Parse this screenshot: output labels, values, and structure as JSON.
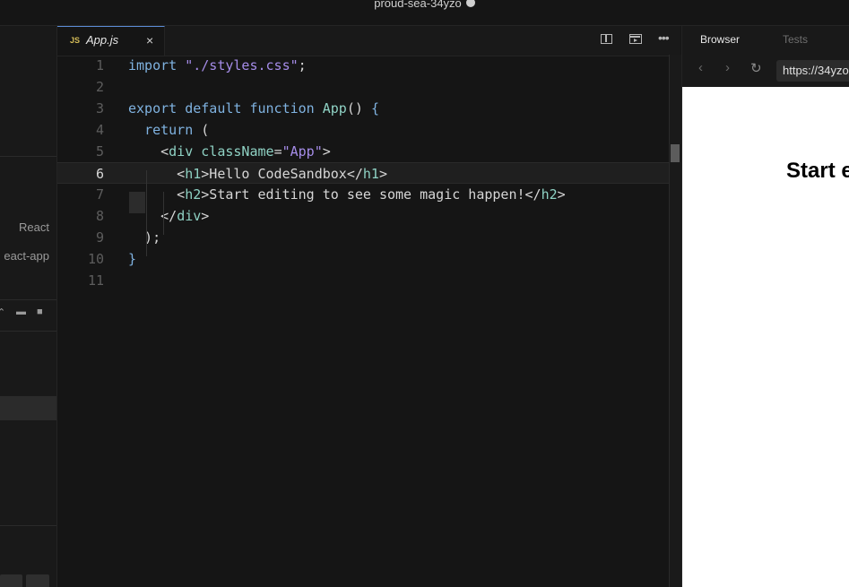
{
  "sandbox": {
    "title": "proud-sea-34yzo"
  },
  "sidebar": {
    "template_label": "React",
    "template_name": "eact-app"
  },
  "editor": {
    "tab": {
      "lang": "JS",
      "filename": "App.js",
      "close": "×"
    },
    "active_line": 6,
    "lines": [
      {
        "n": "1",
        "html": "<span class=\"kw\">import</span> <span class=\"str\">\"./styles.css\"</span>;"
      },
      {
        "n": "2",
        "html": ""
      },
      {
        "n": "3",
        "html": "<span class=\"kw\">export default function</span> <span class=\"fn\">App</span>() <span class=\"br\">{</span>"
      },
      {
        "n": "4",
        "html": "  <span class=\"kw\">return</span> ("
      },
      {
        "n": "5",
        "html": "    &lt;<span class=\"tag\">div</span> <span class=\"attr\">className</span>=<span class=\"str\">\"App\"</span>&gt;"
      },
      {
        "n": "6",
        "html": "      &lt;<span class=\"tag\">h1</span>&gt;Hello CodeSandbox&lt;/<span class=\"tag\">h1</span>&gt;"
      },
      {
        "n": "7",
        "html": "      &lt;<span class=\"tag\">h2</span>&gt;Start editing to see some magic happen!&lt;/<span class=\"tag\">h2</span>&gt;"
      },
      {
        "n": "8",
        "html": "    &lt;/<span class=\"tag\">div</span>&gt;"
      },
      {
        "n": "9",
        "html": "  );"
      },
      {
        "n": "10",
        "html": "<span class=\"br\">}</span>"
      },
      {
        "n": "11",
        "html": ""
      }
    ]
  },
  "preview": {
    "tabs": [
      "Browser",
      "Tests"
    ],
    "active_tab": "Browser",
    "url": "https://34yzo",
    "heading": "Start e"
  },
  "colors": {
    "background": "#151515",
    "accent": "#5b8bd6",
    "preview_bg": "#ffffff"
  }
}
